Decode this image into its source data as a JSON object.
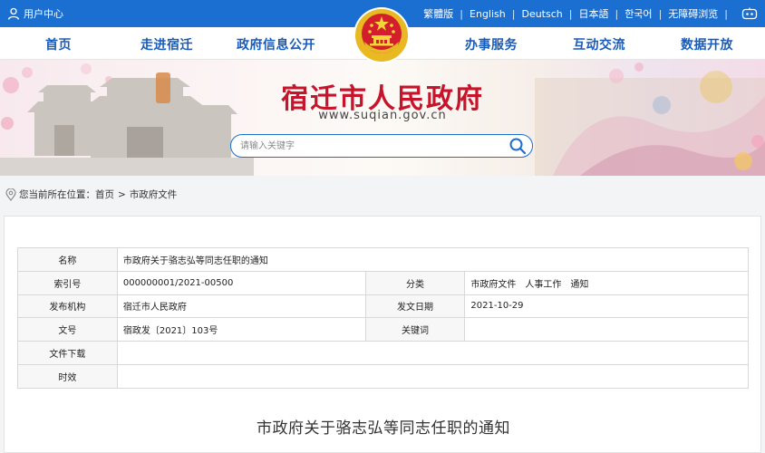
{
  "topbar": {
    "user_center": "用户中心",
    "languages": [
      "繁體版",
      "English",
      "Deutsch",
      "日本語",
      "한국어",
      "无障碍浏览"
    ]
  },
  "nav": {
    "items": [
      "首页",
      "走进宿迁",
      "政府信息公开",
      "办事服务",
      "互动交流",
      "数据开放"
    ]
  },
  "banner": {
    "title": "宿迁市人民政府",
    "url": "www.suqian.gov.cn",
    "search_placeholder": "请输入关键字"
  },
  "breadcrumb": {
    "prefix": "您当前所在位置：",
    "items": [
      "首页",
      "市政府文件"
    ],
    "separator": ">"
  },
  "meta": {
    "name_label": "名称",
    "name_value": "市政府关于骆志弘等同志任职的通知",
    "index_label": "索引号",
    "index_value": "000000001/2021-00500",
    "category_label": "分类",
    "category_value": "市政府文件　人事工作　通知",
    "issuer_label": "发布机构",
    "issuer_value": "宿迁市人民政府",
    "date_label": "发文日期",
    "date_value": "2021-10-29",
    "docno_label": "文号",
    "docno_value": "宿政发〔2021〕103号",
    "keywords_label": "关键词",
    "keywords_value": "",
    "download_label": "文件下载",
    "download_value": "",
    "validity_label": "时效",
    "validity_value": ""
  },
  "document": {
    "title": "市政府关于骆志弘等同志任职的通知"
  },
  "colors": {
    "brand_blue": "#1a6fd0",
    "nav_text": "#1a5bb8",
    "title_red": "#c8142a"
  }
}
